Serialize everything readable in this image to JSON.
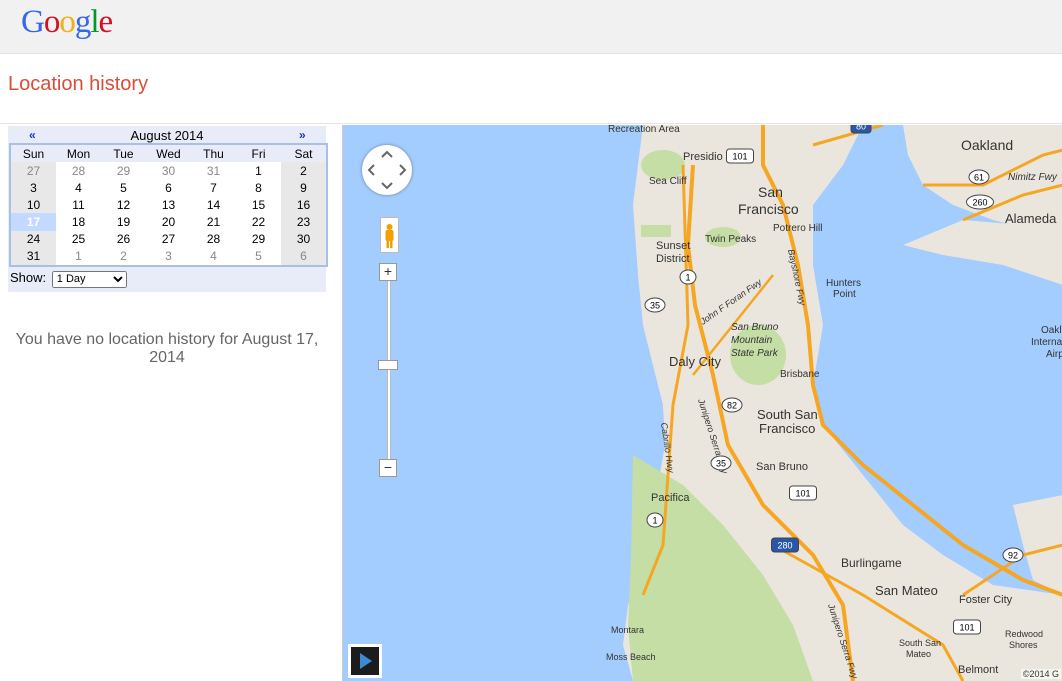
{
  "header": {
    "logo_letters": [
      {
        "ch": "G",
        "color": "#3369e8"
      },
      {
        "ch": "o",
        "color": "#d50f25"
      },
      {
        "ch": "o",
        "color": "#eeb211"
      },
      {
        "ch": "g",
        "color": "#3369e8"
      },
      {
        "ch": "l",
        "color": "#009925"
      },
      {
        "ch": "e",
        "color": "#d50f25"
      }
    ]
  },
  "page_title": "Location history",
  "calendar": {
    "prev": "«",
    "next": "»",
    "month": "August 2014",
    "weekdays": [
      "Sun",
      "Mon",
      "Tue",
      "Wed",
      "Thu",
      "Fri",
      "Sat"
    ],
    "weeks": [
      [
        {
          "d": "27",
          "o": true
        },
        {
          "d": "28",
          "o": true
        },
        {
          "d": "29",
          "o": true
        },
        {
          "d": "30",
          "o": true
        },
        {
          "d": "31",
          "o": true
        },
        {
          "d": "1"
        },
        {
          "d": "2"
        }
      ],
      [
        {
          "d": "3"
        },
        {
          "d": "4"
        },
        {
          "d": "5"
        },
        {
          "d": "6"
        },
        {
          "d": "7"
        },
        {
          "d": "8"
        },
        {
          "d": "9"
        }
      ],
      [
        {
          "d": "10"
        },
        {
          "d": "11"
        },
        {
          "d": "12"
        },
        {
          "d": "13"
        },
        {
          "d": "14"
        },
        {
          "d": "15"
        },
        {
          "d": "16"
        }
      ],
      [
        {
          "d": "17",
          "sel": true
        },
        {
          "d": "18"
        },
        {
          "d": "19"
        },
        {
          "d": "20"
        },
        {
          "d": "21"
        },
        {
          "d": "22"
        },
        {
          "d": "23"
        }
      ],
      [
        {
          "d": "24"
        },
        {
          "d": "25"
        },
        {
          "d": "26"
        },
        {
          "d": "27"
        },
        {
          "d": "28"
        },
        {
          "d": "29"
        },
        {
          "d": "30"
        }
      ],
      [
        {
          "d": "31"
        },
        {
          "d": "1",
          "o": true
        },
        {
          "d": "2",
          "o": true
        },
        {
          "d": "3",
          "o": true
        },
        {
          "d": "4",
          "o": true
        },
        {
          "d": "5",
          "o": true
        },
        {
          "d": "6",
          "o": true
        }
      ]
    ],
    "show_label": "Show:",
    "show_value": "1 Day"
  },
  "no_history_text": "You have no location history for August 17, 2014",
  "map": {
    "labels": {
      "recreation": "Recreation Area",
      "presidio": "Presidio",
      "sea_cliff": "Sea Cliff",
      "san": "San",
      "francisco": "Francisco",
      "potrero": "Potrero Hill",
      "twin_peaks": "Twin Peaks",
      "sunset": "Sunset",
      "district": "District",
      "hunters": "Hunters",
      "point": "Point",
      "oakland": "Oakland",
      "alameda": "Alameda",
      "nimitz": "Nimitz Fwy",
      "bayshore": "Bayshore Fwy",
      "foran": "John F Foran Fwy",
      "sbm1": "San Bruno",
      "sbm2": "Mountain",
      "sbm3": "State Park",
      "daly": "Daly City",
      "brisbane": "Brisbane",
      "ssf1": "South San",
      "ssf2": "Francisco",
      "junipero": "Junipero Serra Fwy",
      "cabrillo": "Cabrillo Hwy",
      "san_bruno": "San Bruno",
      "pacifica": "Pacifica",
      "burlingame": "Burlingame",
      "san_mateo": "San Mateo",
      "foster": "Foster City",
      "redwood1": "Redwood",
      "redwood2": "Shores",
      "montara": "Montara",
      "moss": "Moss Beach",
      "ssm1": "South San",
      "ssm2": "Mateo",
      "belmont": "Belmont",
      "junipero2": "Junipero Serra Fwy",
      "oak1": "Oakl",
      "oak2": "Interna",
      "oak3": "Airp"
    },
    "shields": {
      "s101a": "101",
      "s80": "80",
      "s61": "61",
      "s260": "260",
      "s1a": "1",
      "s35a": "35",
      "s82": "82",
      "s35b": "35",
      "s101b": "101",
      "s1b": "1",
      "s280": "280",
      "s92": "92",
      "s101c": "101"
    },
    "copyright": "©2014 G"
  }
}
